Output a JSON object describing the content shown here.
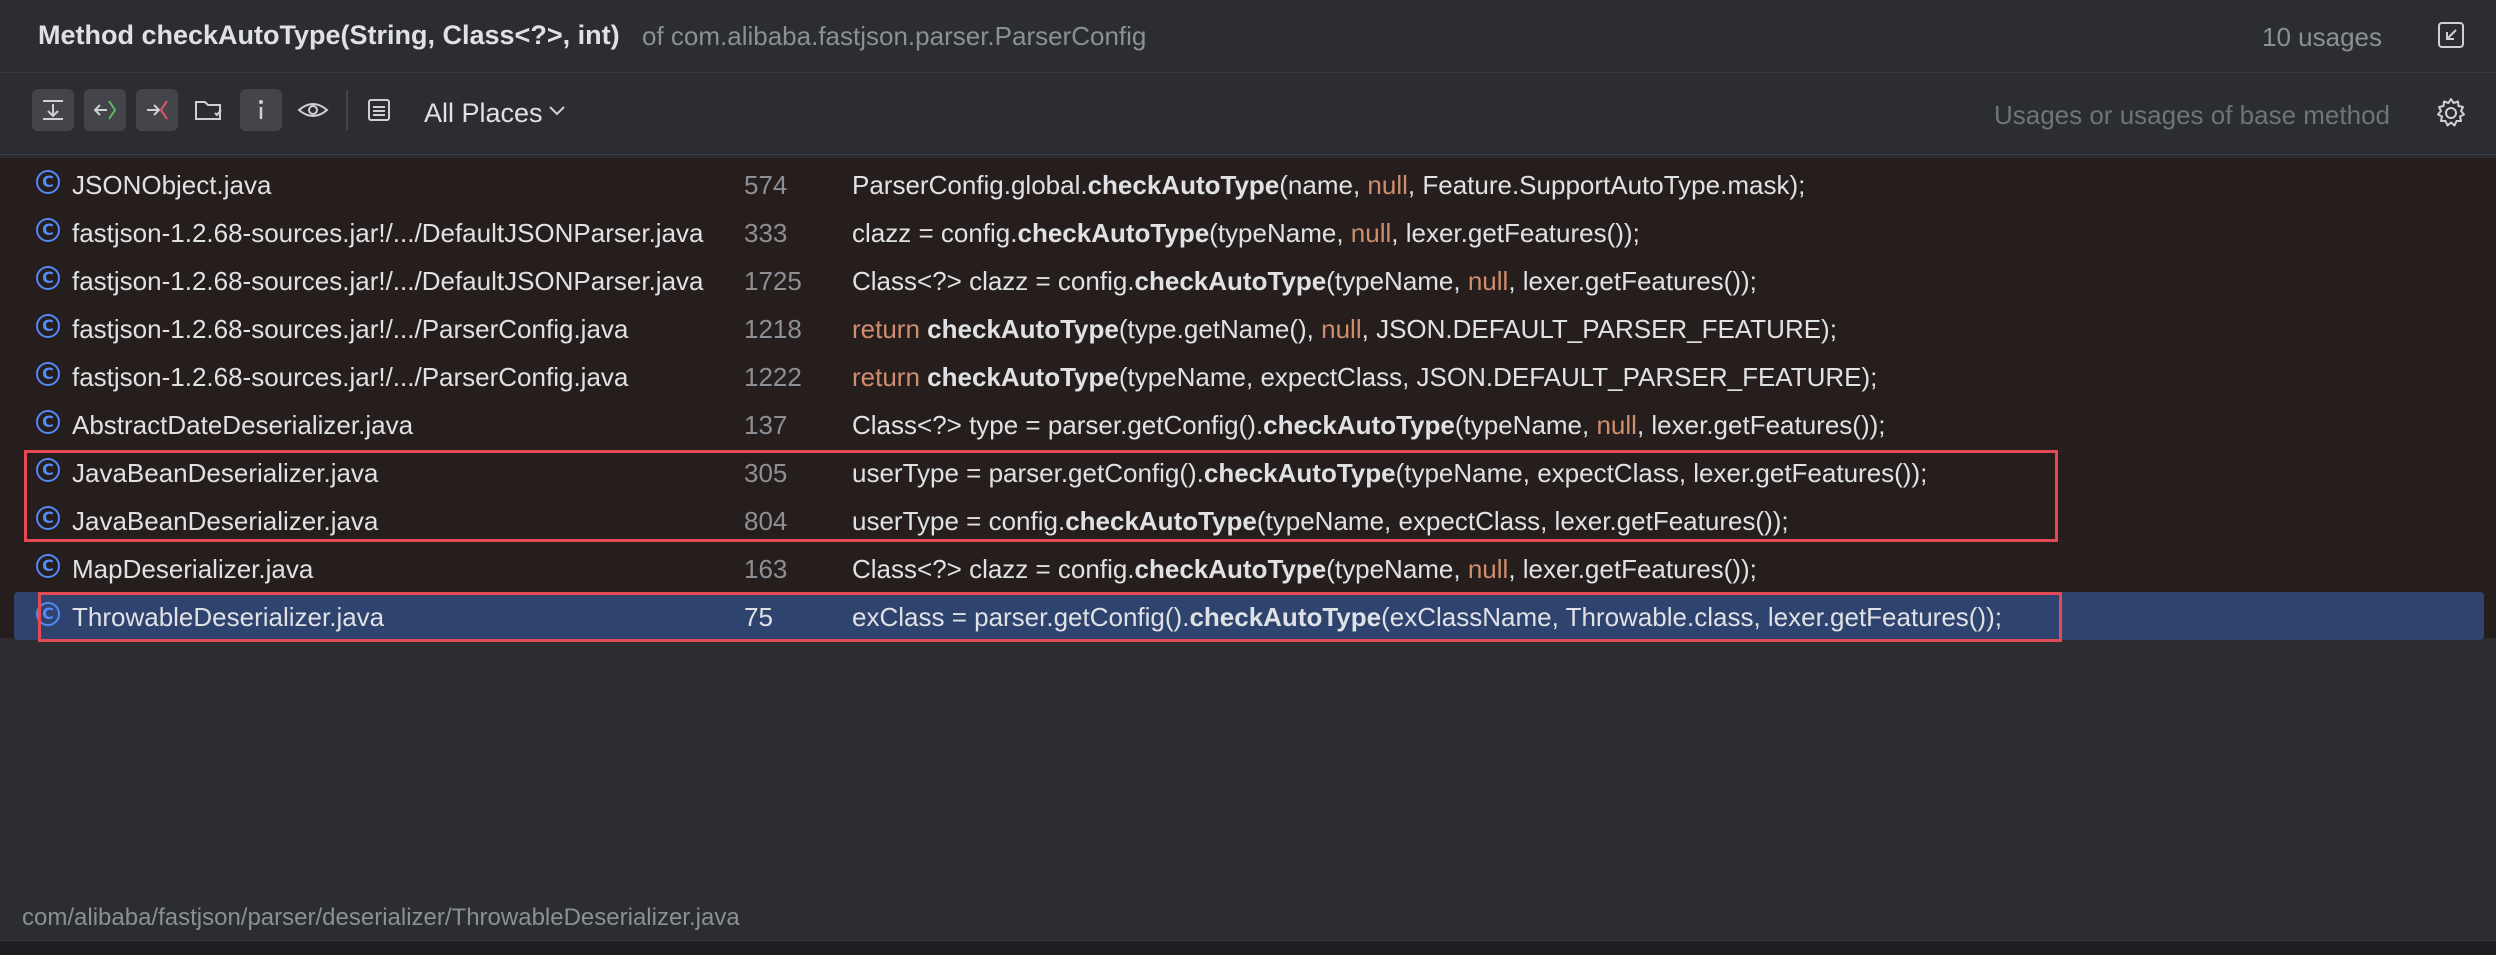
{
  "header": {
    "title": "Method checkAutoType(String, Class<?>, int)",
    "subtitle": "of com.alibaba.fastjson.parser.ParserConfig",
    "usages_count": "10 usages"
  },
  "toolbar": {
    "scope_label": "All Places",
    "filter_placeholder": "Usages or usages of base method",
    "icons": [
      "merge-icon",
      "read-access-icon",
      "write-access-icon",
      "folder-icon",
      "info-icon",
      "eye-icon",
      "preview-icon"
    ]
  },
  "rows": [
    {
      "file": "JSONObject.java",
      "line": "574",
      "code_pre": "ParserConfig.global.",
      "method": "checkAutoType",
      "code_mid": "(name, ",
      "null": "null",
      "code_post": ", Feature.SupportAutoType.mask);",
      "kw": ""
    },
    {
      "file": "fastjson-1.2.68-sources.jar!/.../DefaultJSONParser.java",
      "line": "333",
      "code_pre": "clazz = config.",
      "method": "checkAutoType",
      "code_mid": "(typeName, ",
      "null": "null",
      "code_post": ", lexer.getFeatures());",
      "kw": ""
    },
    {
      "file": "fastjson-1.2.68-sources.jar!/.../DefaultJSONParser.java",
      "line": "1725",
      "code_pre": "Class<?> clazz = config.",
      "method": "checkAutoType",
      "code_mid": "(typeName, ",
      "null": "null",
      "code_post": ", lexer.getFeatures());",
      "kw": ""
    },
    {
      "file": "fastjson-1.2.68-sources.jar!/.../ParserConfig.java",
      "line": "1218",
      "kw": "return ",
      "code_pre": "",
      "method": "checkAutoType",
      "code_mid": "(type.getName(), ",
      "null": "null",
      "code_post": ", JSON.DEFAULT_PARSER_FEATURE);"
    },
    {
      "file": "fastjson-1.2.68-sources.jar!/.../ParserConfig.java",
      "line": "1222",
      "kw": "return ",
      "code_pre": "",
      "method": "checkAutoType",
      "code_mid": "(typeName, expectClass, JSON.DEFAULT_PARSER_FEATURE);",
      "null": "",
      "code_post": ""
    },
    {
      "file": "AbstractDateDeserializer.java",
      "line": "137",
      "code_pre": "Class<?> type = parser.getConfig().",
      "method": "checkAutoType",
      "code_mid": "(typeName, ",
      "null": "null",
      "code_post": ", lexer.getFeatures());",
      "kw": ""
    },
    {
      "file": "JavaBeanDeserializer.java",
      "line": "305",
      "code_pre": "userType = parser.getConfig().",
      "method": "checkAutoType",
      "code_mid": "(typeName, expectClass, lexer.getFeatures());",
      "null": "",
      "code_post": "",
      "kw": ""
    },
    {
      "file": "JavaBeanDeserializer.java",
      "line": "804",
      "code_pre": "userType = config.",
      "method": "checkAutoType",
      "code_mid": "(typeName, expectClass, lexer.getFeatures());",
      "null": "",
      "code_post": "",
      "kw": ""
    },
    {
      "file": "MapDeserializer.java",
      "line": "163",
      "code_pre": "Class<?> clazz = config.",
      "method": "checkAutoType",
      "code_mid": "(typeName, ",
      "null": "null",
      "code_post": ", lexer.getFeatures());",
      "kw": ""
    },
    {
      "file": "ThrowableDeserializer.java",
      "line": "75",
      "code_pre": "exClass = parser.getConfig().",
      "method": "checkAutoType",
      "code_mid": "(exClassName, Throwable.class, lexer.getFeatures());",
      "null": "",
      "code_post": "",
      "kw": ""
    }
  ],
  "selected_index": 9,
  "status_path": "com/alibaba/fastjson/parser/deserializer/ThrowableDeserializer.java",
  "colors": {
    "accent": "#548af7",
    "selection": "#2e436e",
    "highlight_box": "#e24b53",
    "keyword": "#cf8e6d"
  }
}
